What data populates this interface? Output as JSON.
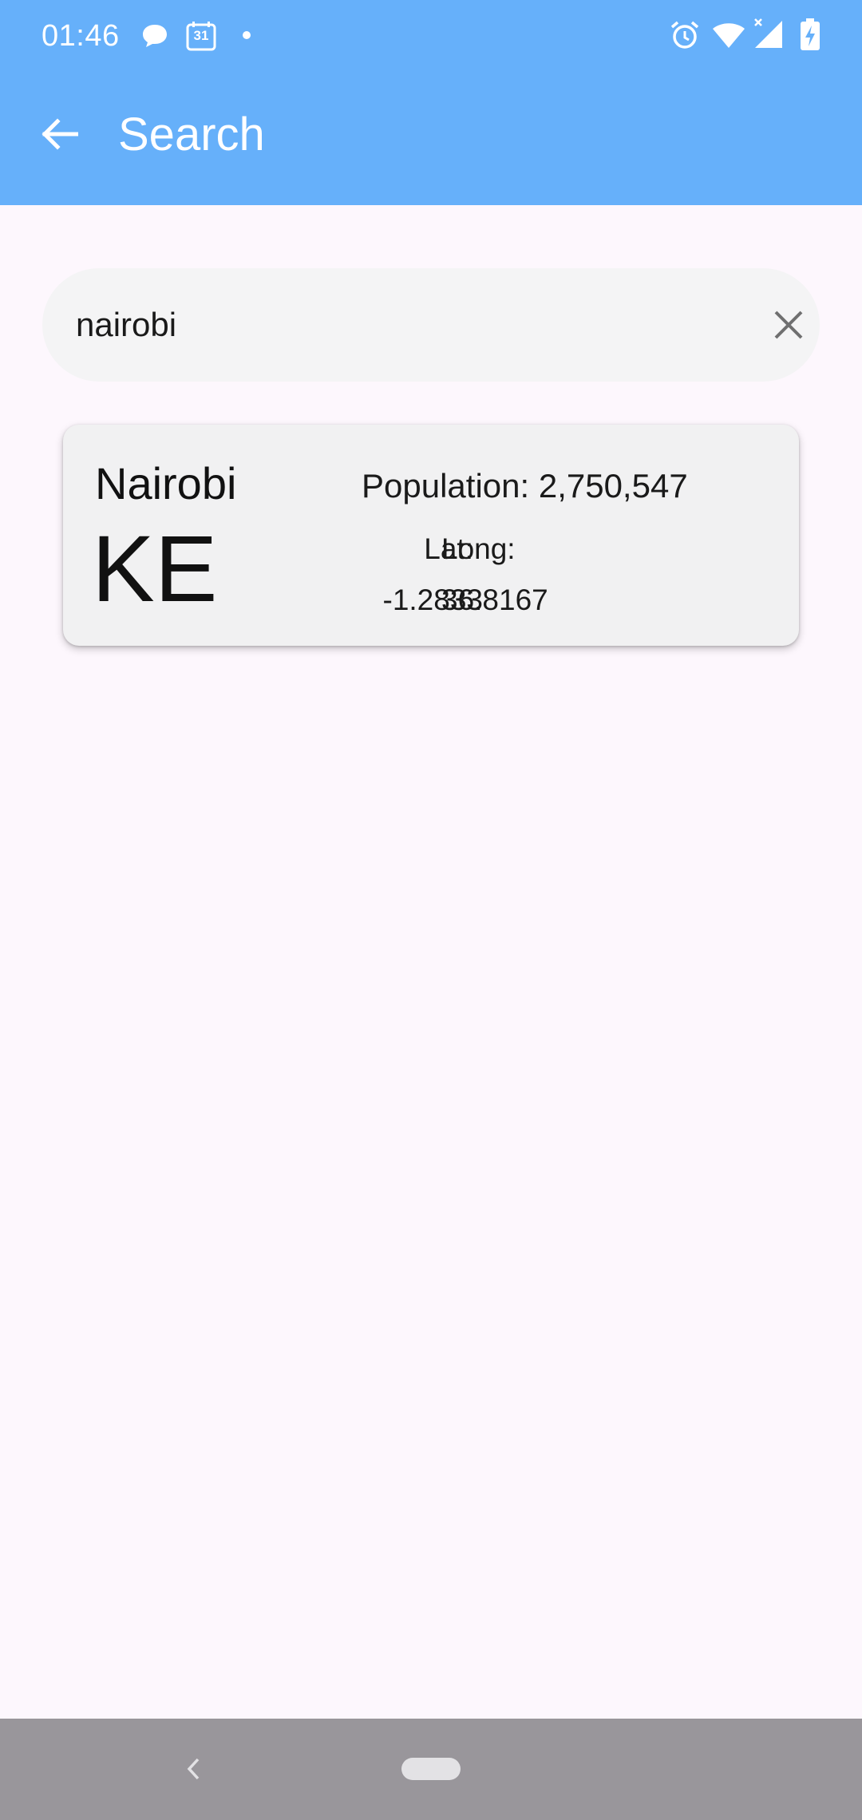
{
  "status_bar": {
    "time": "01:46",
    "calendar_day": "31",
    "left_icons": [
      "chat-bubble-icon",
      "calendar-icon",
      "dot-icon"
    ],
    "right_icons": [
      "alarm-icon",
      "wifi-icon",
      "signal-icon",
      "battery-charging-icon"
    ]
  },
  "app_bar": {
    "title": "Search",
    "back_icon": "arrow-left-icon"
  },
  "search": {
    "value": "nairobi",
    "clear_icon": "close-icon"
  },
  "result": {
    "city": "Nairobi",
    "country_code": "KE",
    "population_text": "Population: 2,750,547",
    "lat_label": "Lat:",
    "long_label": "Long:",
    "lat_value": "-1.2833",
    "long_value": "36.8167"
  },
  "nav_bar": {
    "back_icon": "chevron-left-icon",
    "home_icon": "home-pill-icon"
  },
  "colors": {
    "app_bar": "#66B0FA",
    "background": "#FDF7FD",
    "search_field": "#F4F4F5",
    "card": "#F1F1F2",
    "nav_bar": "#99969B"
  }
}
